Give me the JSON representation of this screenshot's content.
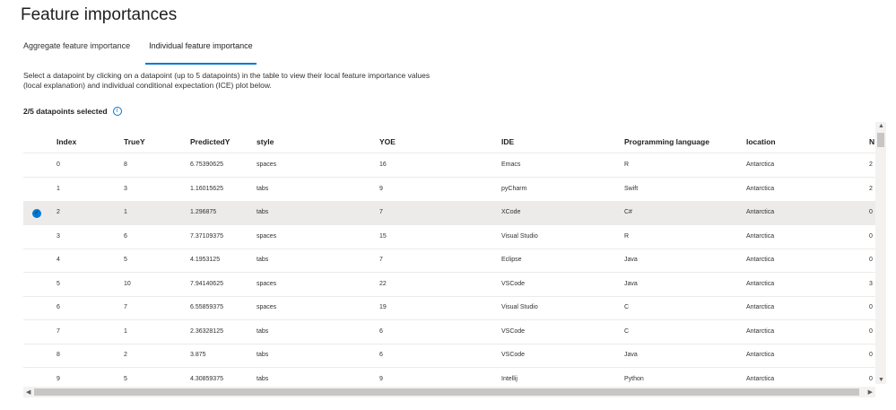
{
  "title": "Feature importances",
  "tabs": [
    {
      "label": "Aggregate feature importance",
      "active": false
    },
    {
      "label": "Individual feature importance",
      "active": true
    }
  ],
  "description": "Select a datapoint by clicking on a datapoint (up to 5 datapoints) in the table to view their local feature importance values (local explanation) and individual conditional expectation (ICE) plot below.",
  "selection_status": "2/5 datapoints selected",
  "info_glyph": "i",
  "columns": [
    "Index",
    "TrueY",
    "PredictedY",
    "style",
    "YOE",
    "IDE",
    "Programming language",
    "location",
    "N"
  ],
  "rows": [
    {
      "cells": [
        "0",
        "8",
        "6.75390625",
        "spaces",
        "16",
        "Emacs",
        "R",
        "Antarctica",
        "2"
      ],
      "selected": false
    },
    {
      "cells": [
        "1",
        "3",
        "1.16015625",
        "tabs",
        "9",
        "pyCharm",
        "Swift",
        "Antarctica",
        "2"
      ],
      "selected": false
    },
    {
      "cells": [
        "2",
        "1",
        "1.296875",
        "tabs",
        "7",
        "XCode",
        "C#",
        "Antarctica",
        "0"
      ],
      "selected": true
    },
    {
      "cells": [
        "3",
        "6",
        "7.37109375",
        "spaces",
        "15",
        "Visual Studio",
        "R",
        "Antarctica",
        "0"
      ],
      "selected": false
    },
    {
      "cells": [
        "4",
        "5",
        "4.1953125",
        "tabs",
        "7",
        "Eclipse",
        "Java",
        "Antarctica",
        "0"
      ],
      "selected": false
    },
    {
      "cells": [
        "5",
        "10",
        "7.94140625",
        "spaces",
        "22",
        "VSCode",
        "Java",
        "Antarctica",
        "3"
      ],
      "selected": false
    },
    {
      "cells": [
        "6",
        "7",
        "6.55859375",
        "spaces",
        "19",
        "Visual Studio",
        "C",
        "Antarctica",
        "0"
      ],
      "selected": false
    },
    {
      "cells": [
        "7",
        "1",
        "2.36328125",
        "tabs",
        "6",
        "VSCode",
        "C",
        "Antarctica",
        "0"
      ],
      "selected": false
    },
    {
      "cells": [
        "8",
        "2",
        "3.875",
        "tabs",
        "6",
        "VSCode",
        "Java",
        "Antarctica",
        "0"
      ],
      "selected": false
    },
    {
      "cells": [
        "9",
        "5",
        "4.30859375",
        "tabs",
        "9",
        "Intellij",
        "Python",
        "Antarctica",
        "0"
      ],
      "selected": false
    }
  ],
  "icons": {
    "row_selected": "checkmark-circle-icon",
    "check_glyph": "✓",
    "info": "info-icon"
  },
  "colors": {
    "accent": "#0078d4",
    "selected_row": "#edebe9"
  }
}
